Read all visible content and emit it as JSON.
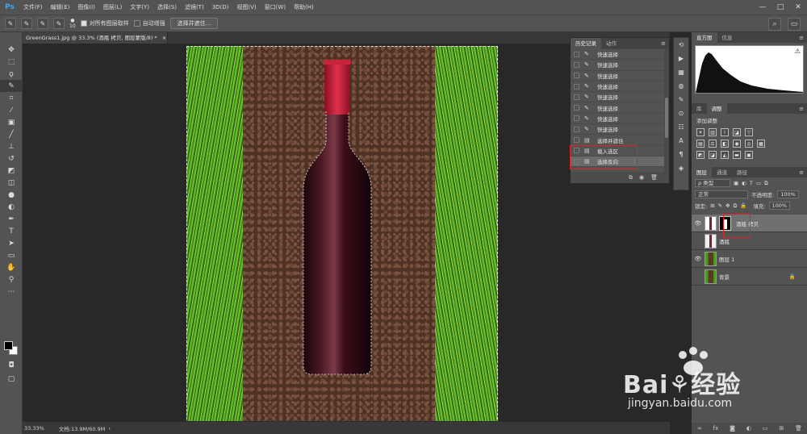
{
  "app": {
    "logo": "Ps"
  },
  "menu": [
    "文件(F)",
    "编辑(E)",
    "图像(I)",
    "图层(L)",
    "文字(Y)",
    "选择(S)",
    "滤镜(T)",
    "3D(D)",
    "视图(V)",
    "窗口(W)",
    "帮助(H)"
  ],
  "window_controls": [
    "—",
    "□",
    "✕"
  ],
  "options_bar": {
    "brush_size": "10",
    "sample_all_layers": "对所有图层取样",
    "auto_enhance": "自动增强",
    "select_and_mask": "选择并遮住..."
  },
  "document": {
    "tab_title": "GreenGrass1.jpg @ 33.3% (酒瓶 拷贝, 图层蒙版/8) *",
    "tab_close": "×"
  },
  "status": {
    "zoom": "33.33%",
    "doc_size": "文档:13.9M/60.9M"
  },
  "history_panel": {
    "tabs": [
      "历史记录",
      "动作"
    ],
    "menu": "≡",
    "items": [
      {
        "label": "快速选择",
        "icon": "quick-select"
      },
      {
        "label": "快速选择",
        "icon": "quick-select"
      },
      {
        "label": "快速选择",
        "icon": "quick-select"
      },
      {
        "label": "快速选择",
        "icon": "quick-select"
      },
      {
        "label": "快速选择",
        "icon": "quick-select"
      },
      {
        "label": "快速选择",
        "icon": "quick-select"
      },
      {
        "label": "快速选择",
        "icon": "quick-select"
      },
      {
        "label": "快速选择",
        "icon": "quick-select"
      },
      {
        "label": "选择并遮住",
        "icon": "document"
      },
      {
        "label": "载入选区",
        "icon": "document"
      },
      {
        "label": "选择反向",
        "icon": "document"
      }
    ],
    "selected_index": 10
  },
  "histogram_panel": {
    "tabs": [
      "直方图",
      "信息"
    ]
  },
  "adjustments_panel": {
    "tabs": [
      "库",
      "调整"
    ],
    "title": "添加调整"
  },
  "layers_panel": {
    "tabs": [
      "图层",
      "通道",
      "路径"
    ],
    "filter_kind": "ρ 类型",
    "blend_mode": "正常",
    "opacity_label": "不透明度:",
    "opacity_value": "100%",
    "lock_label": "锁定:",
    "fill_label": "填充:",
    "fill_value": "100%",
    "layers": [
      {
        "name": "酒瓶 拷贝",
        "visible": true,
        "has_mask": true,
        "active": true
      },
      {
        "name": "酒瓶",
        "visible": false,
        "has_mask": false,
        "active": false
      },
      {
        "name": "图层 1",
        "visible": true,
        "has_mask": false,
        "active": false
      },
      {
        "name": "背景",
        "visible": false,
        "has_mask": false,
        "active": false,
        "locked": true
      }
    ]
  },
  "watermark": {
    "brand": "Bai⚘经验",
    "url": "jingyan.baidu.com"
  },
  "colors": {
    "highlight": "#e3202a",
    "panel": "#535353",
    "canvas_bg": "#282828"
  }
}
